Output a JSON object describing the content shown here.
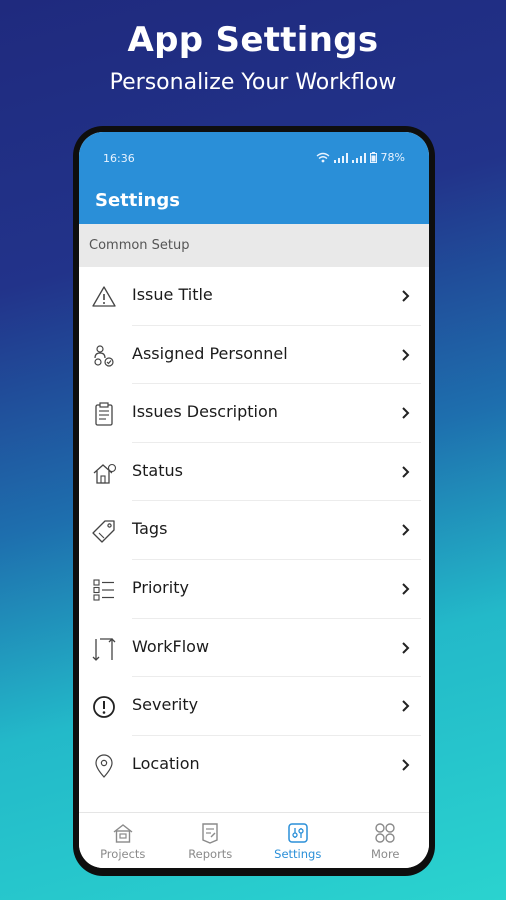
{
  "promo": {
    "title": "App Settings",
    "subtitle": "Personalize Your Workflow"
  },
  "status_bar": {
    "time": "16:36",
    "battery": "78%"
  },
  "app_bar": {
    "title": "Settings"
  },
  "section_header": "Common Setup",
  "settings_items": [
    {
      "label": "Issue Title",
      "icon": "warning-icon"
    },
    {
      "label": "Assigned Personnel",
      "icon": "personnel-icon"
    },
    {
      "label": "Issues Description",
      "icon": "clipboard-icon"
    },
    {
      "label": "Status",
      "icon": "house-status-icon"
    },
    {
      "label": "Tags",
      "icon": "tag-icon"
    },
    {
      "label": "Priority",
      "icon": "priority-list-icon"
    },
    {
      "label": "WorkFlow",
      "icon": "workflow-icon"
    },
    {
      "label": "Severity",
      "icon": "exclamation-circle-icon"
    },
    {
      "label": "Location",
      "icon": "location-pin-icon"
    }
  ],
  "bottom_nav": [
    {
      "label": "Projects",
      "icon": "projects-icon",
      "active": false
    },
    {
      "label": "Reports",
      "icon": "reports-icon",
      "active": false
    },
    {
      "label": "Settings",
      "icon": "settings-icon",
      "active": true
    },
    {
      "label": "More",
      "icon": "more-grid-icon",
      "active": false
    }
  ],
  "colors": {
    "accent": "#2a8fd8",
    "section_bg": "#e9e9e9",
    "inactive_nav": "#8a8a8a"
  }
}
